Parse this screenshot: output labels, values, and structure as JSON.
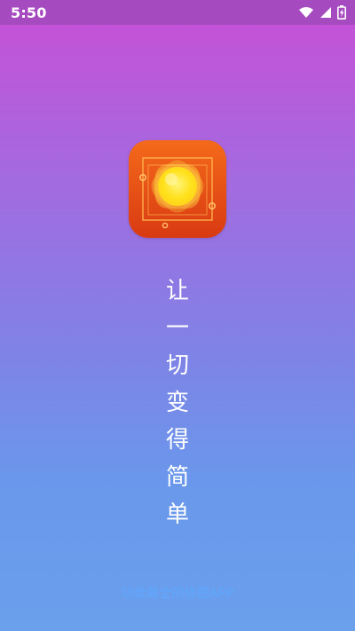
{
  "status_bar": {
    "time": "5:50",
    "icons": [
      "wifi-icon",
      "signal-icon",
      "battery-icon"
    ],
    "background": "#a64bbf"
  },
  "slogan": {
    "chars": [
      "让",
      "一",
      "切",
      "变",
      "得",
      "简",
      "单"
    ]
  },
  "footer": {
    "text": "功能最全的修图APP"
  },
  "colors": {
    "gradient_top": "#c84fd6",
    "gradient_bottom": "#6aa0ec",
    "logo_orange": "#f46a1a",
    "logo_yellow": "#ffe11b",
    "footer_text": "#5fa7ff"
  }
}
